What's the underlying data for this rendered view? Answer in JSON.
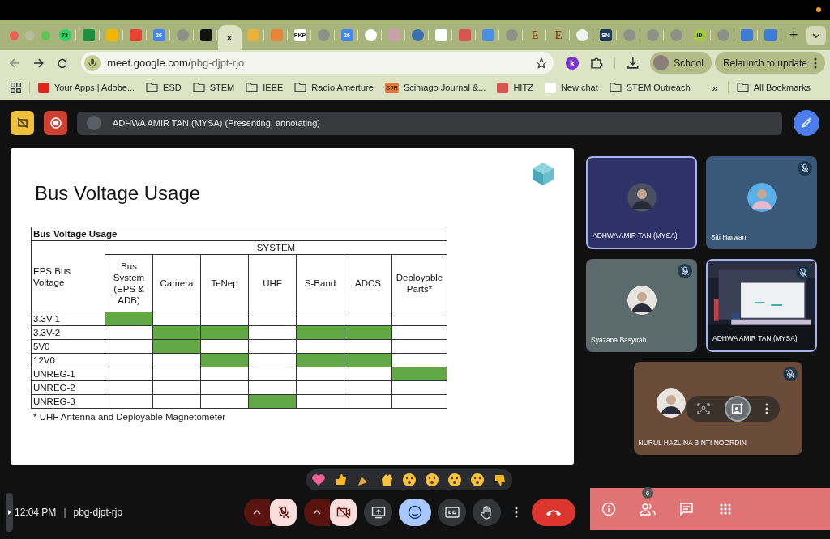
{
  "browser": {
    "tabs": [
      {
        "kind": "circle",
        "color": "#25d366",
        "badge": "73",
        "selected": false
      },
      {
        "kind": "square",
        "color": "#1e8e3e",
        "selected": false
      },
      {
        "kind": "square",
        "color": "#f4b400",
        "selected": false
      },
      {
        "kind": "square",
        "color": "#ea4335",
        "selected": false
      },
      {
        "kind": "square",
        "color": "#4285f4",
        "badge": "26",
        "selected": false
      },
      {
        "kind": "circle",
        "color": "#8e9088",
        "selected": false
      },
      {
        "kind": "square",
        "color": "#111111",
        "selected": false
      },
      {
        "kind": "close",
        "close": "×",
        "selected": true
      },
      {
        "kind": "square",
        "color": "#e8b13a",
        "selected": false
      },
      {
        "kind": "square",
        "color": "#e8843a",
        "selected": false
      },
      {
        "kind": "square",
        "color": "#ffffff",
        "badge": "PKP",
        "selected": false
      },
      {
        "kind": "circle",
        "color": "#8e9088",
        "selected": false
      },
      {
        "kind": "square",
        "color": "#4285f4",
        "badge": "26",
        "selected": false
      },
      {
        "kind": "circle",
        "color": "#ffffff",
        "selected": false
      },
      {
        "kind": "square",
        "color": "#c8a0a8",
        "selected": false
      },
      {
        "kind": "circle",
        "color": "#3a6fb0",
        "selected": false
      },
      {
        "kind": "square",
        "color": "#ffffff",
        "selected": false
      },
      {
        "kind": "square",
        "color": "#d9534f",
        "selected": false
      },
      {
        "kind": "square",
        "color": "#4a90e2",
        "selected": false
      },
      {
        "kind": "circle",
        "color": "#8e9088",
        "selected": false
      },
      {
        "kind": "letter",
        "color": "#8a3206",
        "badge": "E",
        "selected": false
      },
      {
        "kind": "letter",
        "color": "#8a3206",
        "badge": "E",
        "selected": false
      },
      {
        "kind": "circle",
        "color": "#f2f2f2",
        "selected": false
      },
      {
        "kind": "square",
        "color": "#1b3a5c",
        "badge": "SN",
        "selected": false
      },
      {
        "kind": "circle",
        "color": "#8e9088",
        "selected": false
      },
      {
        "kind": "circle",
        "color": "#8e9088",
        "selected": false
      },
      {
        "kind": "circle",
        "color": "#8e9088",
        "selected": false
      },
      {
        "kind": "circle",
        "color": "#a6ce39",
        "badge": "iD",
        "selected": false
      },
      {
        "kind": "circle",
        "color": "#8e9088",
        "selected": false
      },
      {
        "kind": "square",
        "color": "#3b7dd8",
        "selected": false
      },
      {
        "kind": "square",
        "color": "#3b7dd8",
        "selected": false
      }
    ],
    "new_tab": "+",
    "url_host": "meet.google.com/",
    "url_path": "pbg-djpt-rjo",
    "extension_badge": "k",
    "profile": "School",
    "relaunch": "Relaunch to update",
    "bookmarks": [
      {
        "kind": "site",
        "color": "#e1251b",
        "label": "Your Apps | Adobe..."
      },
      {
        "kind": "folder",
        "label": "ESD"
      },
      {
        "kind": "folder",
        "label": "STEM"
      },
      {
        "kind": "folder",
        "label": "IEEE"
      },
      {
        "kind": "folder",
        "label": "Radio Amerture"
      },
      {
        "kind": "site",
        "color": "#e8743a",
        "badge": "SJR",
        "label": "Scimago Journal &..."
      },
      {
        "kind": "site",
        "color": "#d9534f",
        "label": "HITZ"
      },
      {
        "kind": "site",
        "color": "#ffffff",
        "label": "New chat"
      },
      {
        "kind": "folder",
        "label": "STEM Outreach"
      }
    ],
    "more_bookmarks": "»",
    "all_bookmarks": "All Bookmarks"
  },
  "meet": {
    "presenter": "ADHWA AMIR TAN (MYSA) (Presenting, annotating)",
    "slide": {
      "title": "Bus Voltage Usage",
      "table": {
        "title": "Bus Voltage Usage",
        "row_header": "EPS Bus Voltage",
        "group_header": "SYSTEM",
        "columns": [
          "Bus System (EPS & ADB)",
          "Camera",
          "TeNep",
          "UHF",
          "S-Band",
          "ADCS",
          "Deployable Parts*"
        ],
        "rows": [
          {
            "label": "3.3V-1",
            "cells": [
              true,
              false,
              false,
              false,
              false,
              false,
              false
            ]
          },
          {
            "label": "3.3V-2",
            "cells": [
              false,
              true,
              true,
              false,
              true,
              true,
              false
            ]
          },
          {
            "label": "5V0",
            "cells": [
              false,
              true,
              false,
              false,
              false,
              false,
              false
            ]
          },
          {
            "label": "12V0",
            "cells": [
              false,
              false,
              true,
              false,
              true,
              true,
              false
            ]
          },
          {
            "label": "UNREG-1",
            "cells": [
              false,
              false,
              false,
              false,
              false,
              false,
              true
            ]
          },
          {
            "label": "UNREG-2",
            "cells": [
              false,
              false,
              false,
              false,
              false,
              false,
              false
            ]
          },
          {
            "label": "UNREG-3",
            "cells": [
              false,
              false,
              false,
              true,
              false,
              false,
              false
            ]
          }
        ]
      },
      "footnote": "* UHF Antenna and Deployable Magnetometer"
    },
    "participants": [
      {
        "name": "ADHWA AMIR TAN (MYSA)",
        "kind": "avatar",
        "color": "#2e3268",
        "muted": false,
        "highlighted": true
      },
      {
        "name": "Siti Harwani",
        "kind": "avatar",
        "color": "#3a5878",
        "muted": true,
        "highlighted": false
      },
      {
        "name": "Syazana Basyirah",
        "kind": "avatar",
        "color": "#5b6b6b",
        "muted": true,
        "highlighted": false
      },
      {
        "name": "ADHWA AMIR TAN (MYSA)",
        "kind": "video",
        "color": "#1c2030",
        "muted": true,
        "highlighted": true
      },
      {
        "name": "NURUL HAZLINA BINTI NOORDIN",
        "kind": "hover",
        "color": "#6a4a38",
        "muted": true,
        "highlighted": false
      }
    ],
    "time": "12:04 PM",
    "separator": "|",
    "meeting_code": "pbg-djpt-rjo",
    "controls": [
      {
        "kind": "mic",
        "on": false
      },
      {
        "kind": "camera",
        "on": false
      },
      {
        "kind": "present"
      },
      {
        "kind": "reactions",
        "selected": true
      },
      {
        "kind": "captions",
        "selected": false
      },
      {
        "kind": "hand",
        "selected": false
      },
      {
        "kind": "more"
      },
      {
        "kind": "end"
      }
    ],
    "panel_buttons": [
      {
        "kind": "info"
      },
      {
        "kind": "people",
        "count": "6"
      },
      {
        "kind": "chat"
      },
      {
        "kind": "activities"
      }
    ]
  }
}
